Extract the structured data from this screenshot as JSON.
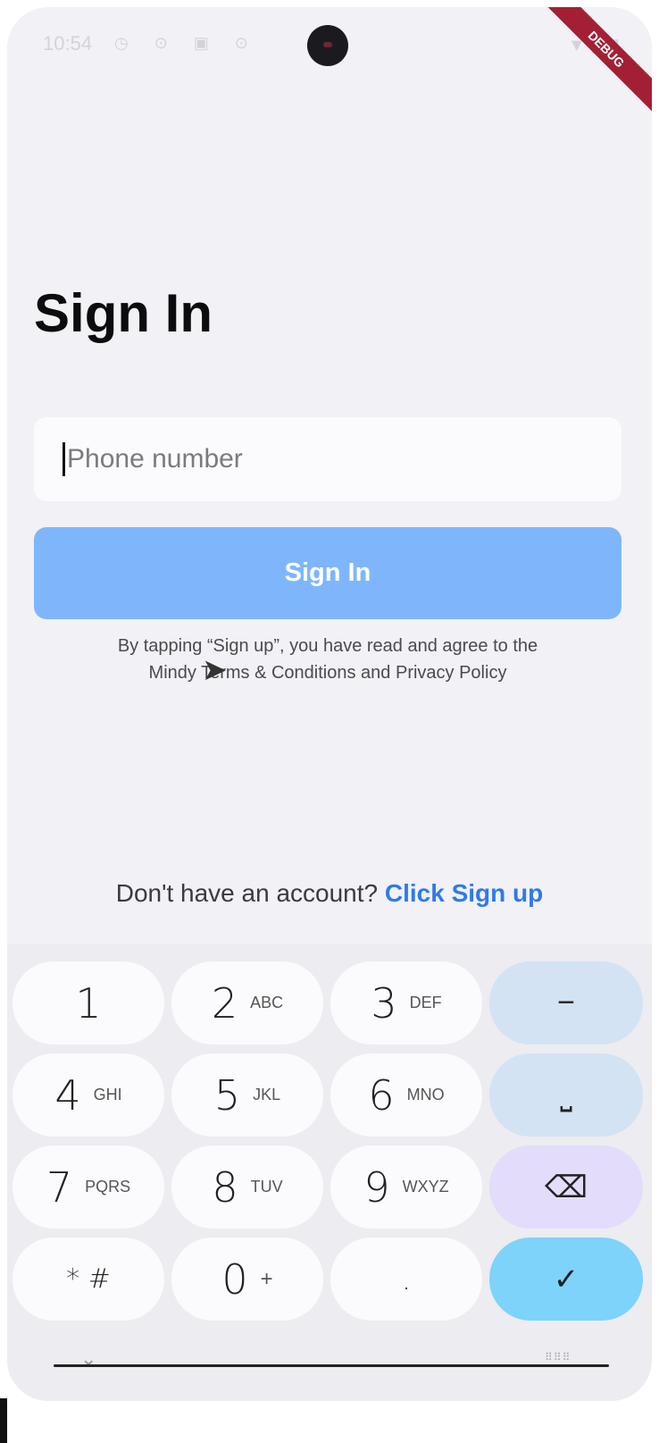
{
  "status_bar": {
    "time": "10:54",
    "left_icons": "◷ ⊙ ▣ ⊙",
    "right_icons": "▼◢▮",
    "debug_label": "DEBUG"
  },
  "page": {
    "title": "Sign In",
    "phone_placeholder": "Phone number",
    "sign_in_label": "Sign In",
    "terms_line1": "By tapping “Sign up”, you have read and agree to the",
    "terms_line2": "Mindy Terms & Conditions and Privacy Policy",
    "signup_prompt": "Don't have an account? ",
    "signup_link": "Click Sign up"
  },
  "keypad": {
    "keys": [
      {
        "digit": "1",
        "letters": ""
      },
      {
        "digit": "2",
        "letters": "ABC"
      },
      {
        "digit": "3",
        "letters": "DEF"
      },
      {
        "digit": "4",
        "letters": "GHI"
      },
      {
        "digit": "5",
        "letters": "JKL"
      },
      {
        "digit": "6",
        "letters": "MNO"
      },
      {
        "digit": "7",
        "letters": "PQRS"
      },
      {
        "digit": "8",
        "letters": "TUV"
      },
      {
        "digit": "9",
        "letters": "WXYZ"
      },
      {
        "digit": "* #",
        "letters": ""
      },
      {
        "digit": "0",
        "letters": "+"
      },
      {
        "digit": ".",
        "letters": ""
      }
    ],
    "function_keys": {
      "minus": "−",
      "space": "⎵",
      "backspace": "⌫",
      "done": "✓"
    }
  },
  "colors": {
    "accent_button": "#7fb6fb",
    "link": "#2f7be8",
    "done_key": "#7dd3fa"
  }
}
